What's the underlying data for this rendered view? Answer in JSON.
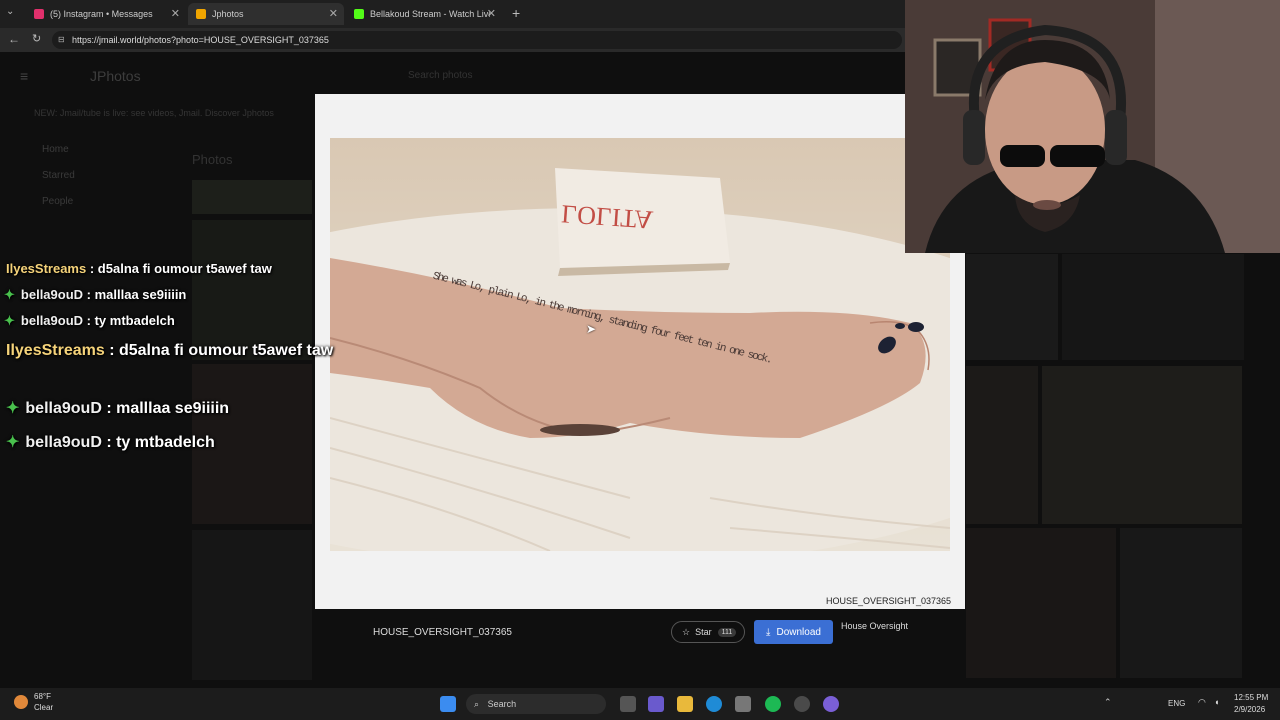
{
  "browser": {
    "tabs": [
      {
        "label": "(5) Instagram • Messages",
        "color": "#e1306c"
      },
      {
        "label": "Jphotos",
        "color": "#f0a500"
      },
      {
        "label": "Bellakoud Stream - Watch Live on",
        "color": "#53fc18"
      }
    ],
    "url": "https://jmail.world/photos?photo=HOUSE_OVERSIGHT_037365"
  },
  "background_page": {
    "app_title": "JPhotos",
    "search_placeholder": "Search photos",
    "banner": "NEW: Jmail/tube is live: see videos, Jmail. Discover Jphotos",
    "sidebar": [
      "Home",
      "Starred",
      "People"
    ],
    "section_title": "Photos"
  },
  "modal": {
    "photo_text": "She was Lo, plain Lo, in the morning, standing four feet ten in one sock.",
    "book_title": "LOLITA",
    "photo_id": "HOUSE_OVERSIGHT_037365"
  },
  "footer": {
    "filename": "HOUSE_OVERSIGHT_037365",
    "star_label": "Star",
    "star_count": "111",
    "download_label": "Download",
    "source": "House Oversight"
  },
  "chat": [
    {
      "user": "IlyesStreams",
      "text": ": d5alna fi oumour t5awef taw",
      "badge": false
    },
    {
      "user": "bella9ouD",
      "text": ": malllaa se9iiiin",
      "badge": true
    },
    {
      "user": "bella9ouD",
      "text": ": ty mtbadelch",
      "badge": true
    },
    {
      "user": "IlyesStreams",
      "text": ": d5alna fi oumour t5awef taw",
      "badge": false
    },
    {
      "user": "bella9ouD",
      "text": ": malllaa se9iiiin",
      "badge": true
    },
    {
      "user": "bella9ouD",
      "text": ": ty mtbadelch",
      "badge": true
    }
  ],
  "taskbar": {
    "weather_temp": "68°F",
    "weather_cond": "Clear",
    "search_label": "Search",
    "lang": "ENG",
    "time": "12:55 PM",
    "date": "2/9/2026"
  }
}
